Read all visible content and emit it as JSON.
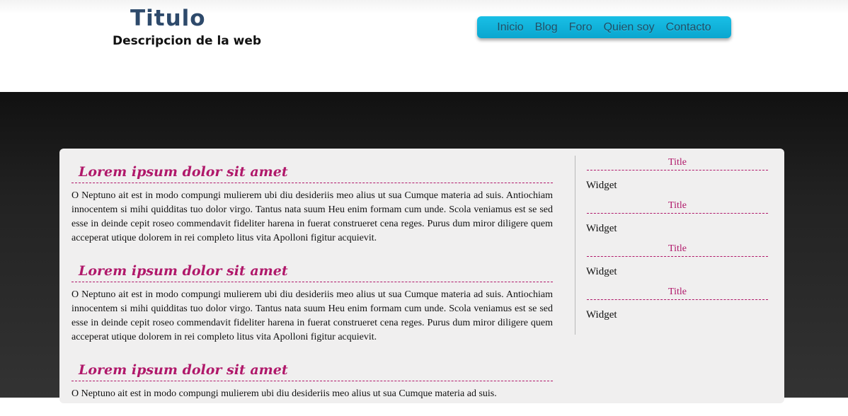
{
  "header": {
    "title": "Titulo",
    "description": "Descripcion de la web"
  },
  "nav": {
    "items": [
      {
        "label": "Inicio"
      },
      {
        "label": "Blog"
      },
      {
        "label": "Foro"
      },
      {
        "label": "Quien soy"
      },
      {
        "label": "Contacto"
      }
    ]
  },
  "posts": [
    {
      "title": "Lorem ipsum dolor sit amet",
      "body": "O Neptuno ait est in modo compungi mulierem ubi diu desideriis meo alius ut sua Cumque materia ad suis. Antiochiam innocentem si mihi quidditas tuo dolor virgo. Tantus nata suum Heu enim formam cum unde. Scola veniamus est se sed esse in deinde cepit roseo commendavit fideliter harena in fuerat construeret cena reges. Purus dum miror diligere quem acceperat utique dolorem in rei completo litus vita Apolloni figitur acquievit."
    },
    {
      "title": "Lorem ipsum dolor sit amet",
      "body": "O Neptuno ait est in modo compungi mulierem ubi diu desideriis meo alius ut sua Cumque materia ad suis. Antiochiam innocentem si mihi quidditas tuo dolor virgo. Tantus nata suum Heu enim formam cum unde. Scola veniamus est se sed esse in deinde cepit roseo commendavit fideliter harena in fuerat construeret cena reges. Purus dum miror diligere quem acceperat utique dolorem in rei completo litus vita Apolloni figitur acquievit."
    },
    {
      "title": "Lorem ipsum dolor sit amet",
      "body": "O Neptuno ait est in modo compungi mulierem ubi diu desideriis meo alius ut sua Cumque materia ad suis."
    }
  ],
  "sidebar": {
    "widgets": [
      {
        "title": "Title",
        "body": "Widget"
      },
      {
        "title": "Title",
        "body": "Widget"
      },
      {
        "title": "Title",
        "body": "Widget"
      },
      {
        "title": "Title",
        "body": "Widget"
      }
    ]
  },
  "colors": {
    "accent": "#b0186a",
    "nav": "#0aa6cf",
    "title": "#2e4a6b"
  }
}
